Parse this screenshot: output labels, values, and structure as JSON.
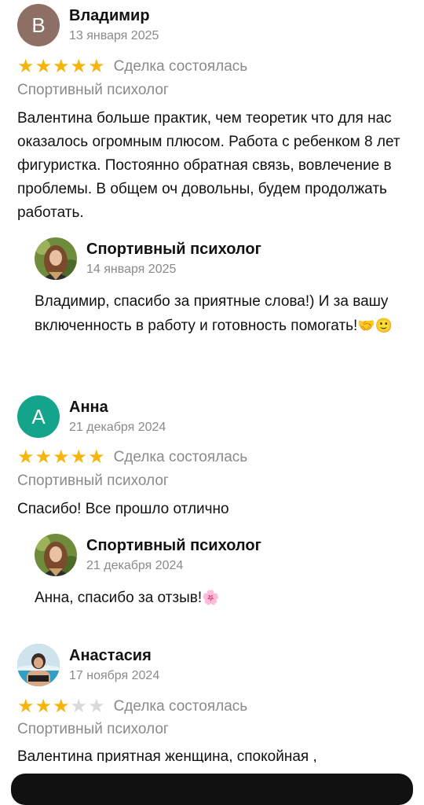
{
  "reviews": [
    {
      "avatar_letter": "В",
      "avatar_color": "#8e6f65",
      "name": "Владимир",
      "date": "13 января 2025",
      "rating": 5,
      "status": "Сделка состоялась",
      "service": "Спортивный психолог",
      "text": "Валентина больше практик, чем теоретик что для нас оказалось огромным плюсом. Работа с ребенком 8 лет фигуристка. Постоянно обратная связь, вовлечение в проблемы. В общем оч довольны, будем продолжать работать.",
      "reply": {
        "name": "Спортивный психолог",
        "date": "14 января 2025",
        "text": "Владимир, спасибо за приятные слова!) И за вашу включенность в работу и готовность помогать!",
        "emoji": "🤝🙂"
      }
    },
    {
      "avatar_letter": "А",
      "avatar_color": "#14a38b",
      "name": "Анна",
      "date": "21 декабря 2024",
      "rating": 5,
      "status": "Сделка состоялась",
      "service": "Спортивный психолог",
      "text": "Спасибо! Все прошло отлично",
      "reply": {
        "name": "Спортивный психолог",
        "date": "21 декабря 2024",
        "text": "Анна, спасибо за отзыв!",
        "emoji": "🌸"
      }
    },
    {
      "avatar_photo": true,
      "name": "Анастасия",
      "date": "17 ноября 2024",
      "rating": 3,
      "status": "Сделка состоялась",
      "service": "Спортивный психолог",
      "text": "Валентина приятная женщина, спокойная ,"
    }
  ],
  "colors": {
    "star_on": "#f5b50a",
    "star_off": "#d9d9d9",
    "muted": "#8a8a8a"
  }
}
